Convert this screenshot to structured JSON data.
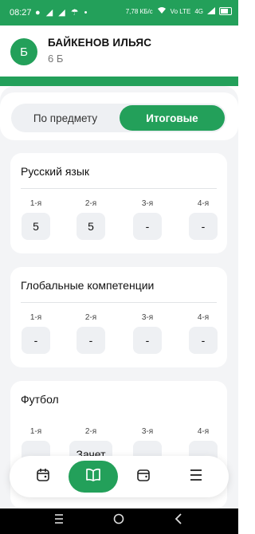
{
  "status_bar": {
    "time": "08:27",
    "left_icons": "● ◢ ◢ ☂ •",
    "network_1": "7,78 КБ/с",
    "network_2": "Vo LTE",
    "network_3": "4G",
    "battery": "battery-icon"
  },
  "profile": {
    "avatar_letter": "Б",
    "name": "БАЙКЕНОВ ИЛЬЯС",
    "class": "6 Б"
  },
  "segment": {
    "left_label": "По предмету",
    "right_label": "Итоговые",
    "active": "right"
  },
  "subjects": [
    {
      "title": "Русский язык",
      "terms": [
        {
          "label": "1-я",
          "grade": "5"
        },
        {
          "label": "2-я",
          "grade": "5"
        },
        {
          "label": "3-я",
          "grade": "-"
        },
        {
          "label": "4-я",
          "grade": "-"
        }
      ]
    },
    {
      "title": "Глобальные компетенции",
      "terms": [
        {
          "label": "1-я",
          "grade": "-"
        },
        {
          "label": "2-я",
          "grade": "-"
        },
        {
          "label": "3-я",
          "grade": "-"
        },
        {
          "label": "4-я",
          "grade": "-"
        }
      ]
    },
    {
      "title": "Футбол",
      "terms": [
        {
          "label": "1-я",
          "grade": ""
        },
        {
          "label": "2-я",
          "grade": "Зачет"
        },
        {
          "label": "3-я",
          "grade": ""
        },
        {
          "label": "4-я",
          "grade": ""
        }
      ]
    }
  ],
  "bottom_nav": {
    "items": [
      "calendar-icon",
      "book-icon",
      "wallet-icon",
      "menu-icon"
    ],
    "active_index": 1
  },
  "colors": {
    "accent": "#23a05a",
    "background": "#f3f4f6",
    "grade_box": "#eef0f3"
  }
}
